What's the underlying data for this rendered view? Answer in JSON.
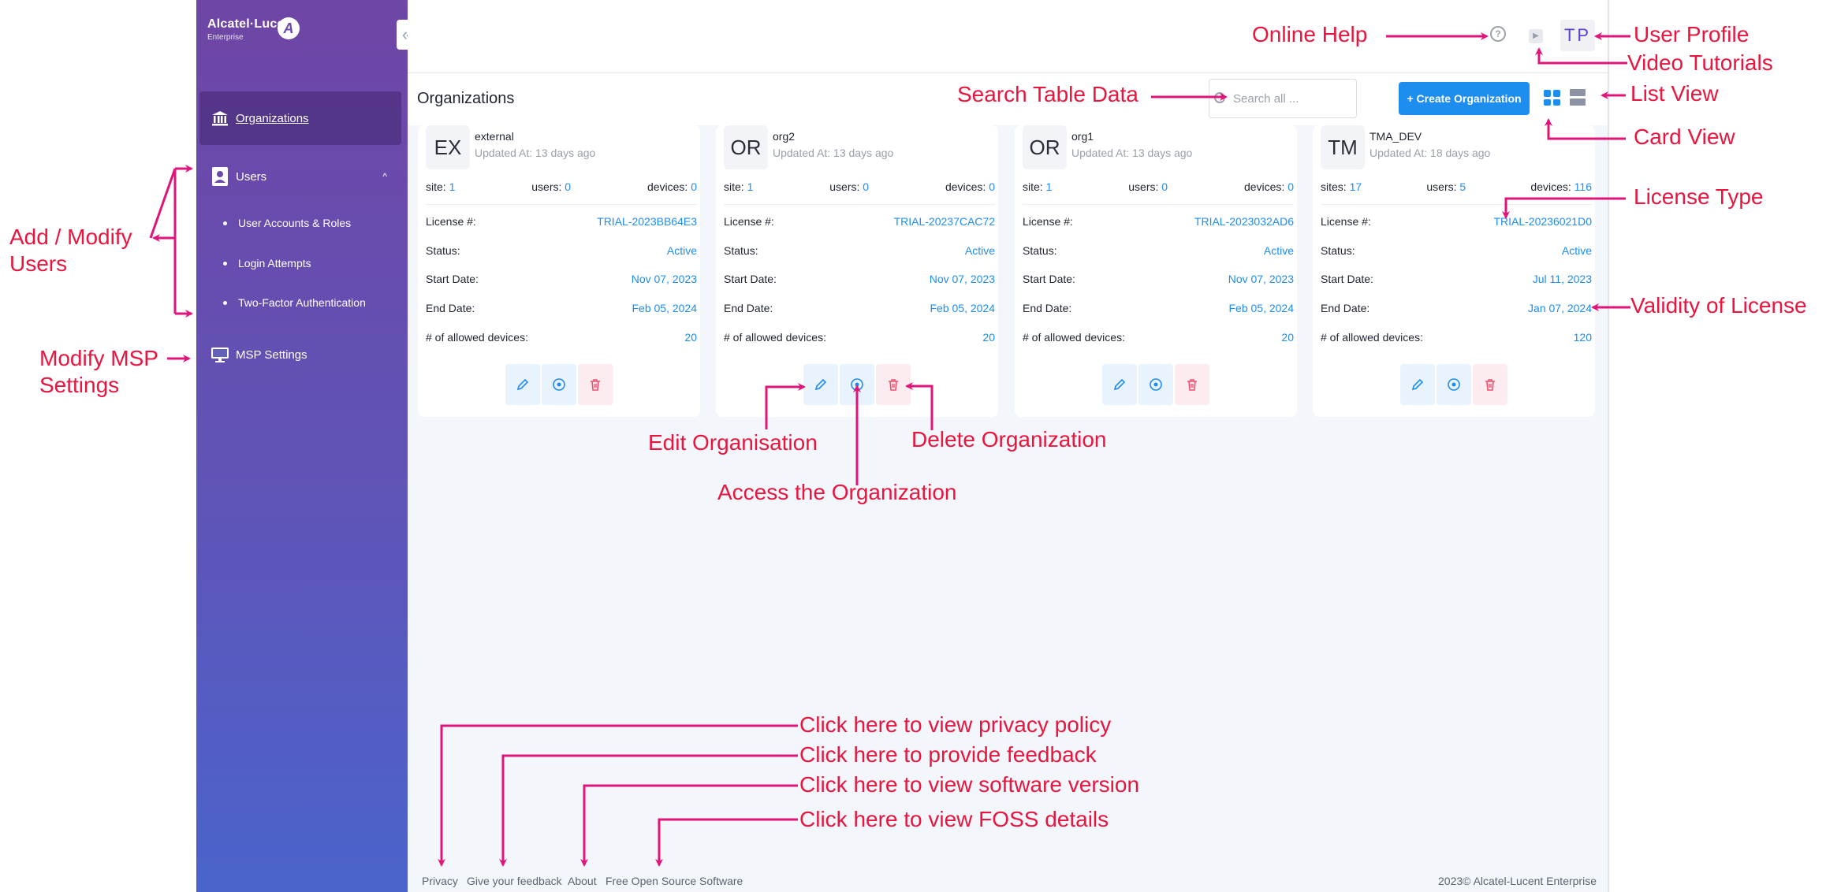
{
  "brand": {
    "name": "Alcatel·Lucent",
    "sub": "Enterprise",
    "logo_glyph": "A"
  },
  "sidebar": {
    "collapse_glyph": "«",
    "items": [
      {
        "label": "Organizations",
        "icon": "bank-icon",
        "active": true
      },
      {
        "label": "Users",
        "icon": "user-card-icon",
        "expanded": true
      },
      {
        "label": "MSP Settings",
        "icon": "monitor-icon"
      }
    ],
    "users_sub": [
      "User Accounts & Roles",
      "Login Attempts",
      "Two-Factor Authentication"
    ],
    "chev": "^"
  },
  "topbar": {
    "help_glyph": "?",
    "video_glyph": "▶",
    "user_initials": "TP"
  },
  "subbar": {
    "title": "Organizations",
    "search_placeholder": "Search all ...",
    "create_label": "+ Create Organization"
  },
  "cards": [
    {
      "initials": "EX",
      "name": "external",
      "updated": "Updated At: 13 days ago",
      "site_label": "site:",
      "site": "1",
      "users_label": "users:",
      "users": "0",
      "devices_label": "devices:",
      "devices": "0",
      "license": "TRIAL-2023BB64E3",
      "status": "Active",
      "start": "Nov 07, 2023",
      "end": "Feb 05, 2024",
      "allowed": "20"
    },
    {
      "initials": "OR",
      "name": "org2",
      "updated": "Updated At: 13 days ago",
      "site_label": "site:",
      "site": "1",
      "users_label": "users:",
      "users": "0",
      "devices_label": "devices:",
      "devices": "0",
      "license": "TRIAL-20237CAC72",
      "status": "Active",
      "start": "Nov 07, 2023",
      "end": "Feb 05, 2024",
      "allowed": "20"
    },
    {
      "initials": "OR",
      "name": "org1",
      "updated": "Updated At: 13 days ago",
      "site_label": "site:",
      "site": "1",
      "users_label": "users:",
      "users": "0",
      "devices_label": "devices:",
      "devices": "0",
      "license": "TRIAL-2023032AD6",
      "status": "Active",
      "start": "Nov 07, 2023",
      "end": "Feb 05, 2024",
      "allowed": "20"
    },
    {
      "initials": "TM",
      "name": "TMA_DEV",
      "updated": "Updated At: 18 days ago",
      "site_label": "sites:",
      "site": "17",
      "users_label": "users:",
      "users": "5",
      "devices_label": "devices:",
      "devices": "116",
      "license": "TRIAL-20236021D0",
      "status": "Active",
      "start": "Jul 11, 2023",
      "end": "Jan 07, 2024",
      "allowed": "120"
    }
  ],
  "card_labels": {
    "license": "License #:",
    "status": "Status:",
    "start": "Start Date:",
    "end": "End Date:",
    "allowed": "# of allowed devices:"
  },
  "footer": {
    "links": [
      "Privacy",
      "Give your feedback",
      "About",
      "Free Open Source Software"
    ],
    "copyright": "2023© Alcatel-Lucent Enterprise"
  },
  "annotations": {
    "online_help": "Online Help",
    "user_profile": "User Profile",
    "video_tutorials": "Video Tutorials",
    "search_table": "Search Table Data",
    "list_view": "List View",
    "card_view": "Card View",
    "license_type": "License Type",
    "validity": "Validity of License",
    "add_modify_users": "Add / Modify Users",
    "modify_msp": "Modify MSP Settings",
    "edit_org": "Edit Organisation",
    "delete_org": "Delete Organization",
    "access_org": "Access the Organization",
    "privacy": "Click here to view privacy policy",
    "feedback": "Click here to provide feedback",
    "version": "Click here to view software version",
    "foss": "Click here to view FOSS details"
  },
  "colors": {
    "annotation": "#e8153e",
    "arrow": "#e0157a",
    "accent": "#1e8df0",
    "sidebar_top": "#6f45a5",
    "sidebar_bottom": "#4a64cc"
  }
}
